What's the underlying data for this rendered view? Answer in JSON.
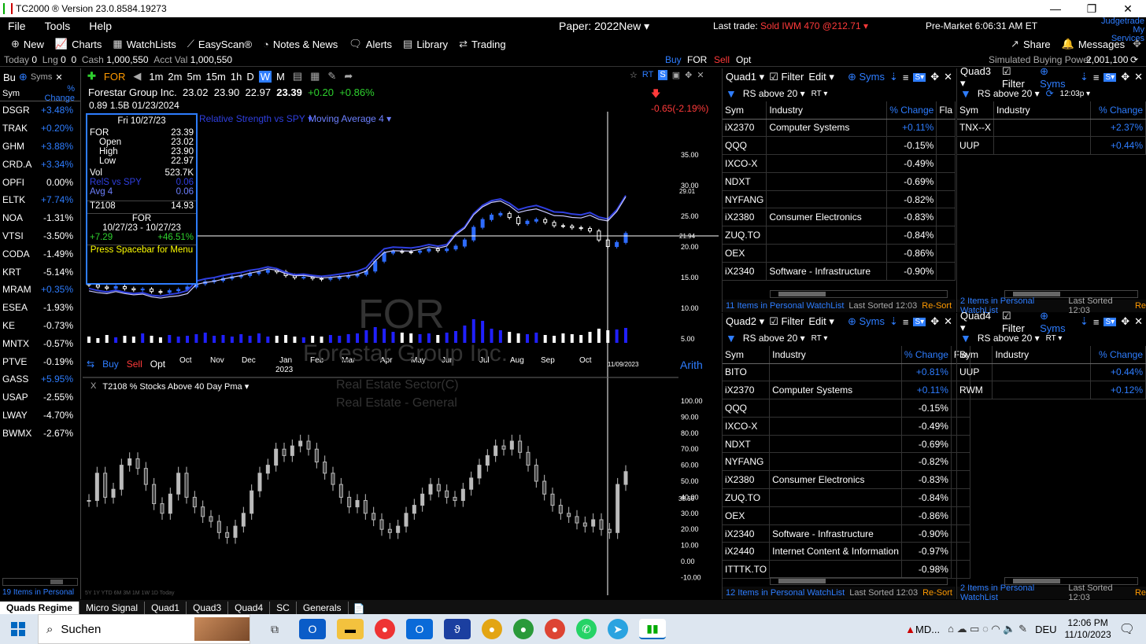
{
  "window": {
    "title": "TC2000 ® Version 23.0.8584.19273"
  },
  "menu": [
    "File",
    "Tools",
    "Help"
  ],
  "account_name": "Paper: 2022New",
  "last_trade": {
    "label": "Last trade:",
    "value": "Sold IWM 470 @212.71"
  },
  "market_status": "Pre-Market 6:06:31 AM ET",
  "brand": [
    "Judgetrade",
    "My Services"
  ],
  "toolbar": {
    "new": "New",
    "charts": "Charts",
    "watchlists": "WatchLists",
    "easyscan": "EasyScan®",
    "notes": "Notes & News",
    "alerts": "Alerts",
    "library": "Library",
    "trading": "Trading",
    "share": "Share",
    "messages": "Messages"
  },
  "acct": {
    "today_label": "Today",
    "today": "0",
    "lng_label": "Lng",
    "lng": "0",
    "val3": "0",
    "cash_label": "Cash",
    "cash": "1,000,550",
    "acctval_label": "Acct Val",
    "acctval": "1,000,550",
    "buy": "Buy",
    "sym": "FOR",
    "sell": "Sell",
    "opt": "Opt",
    "sbp_label": "Simulated Buying Power",
    "sbp": "2,001,100"
  },
  "watchlist": {
    "title": "Bu",
    "syms": "Syms",
    "col_sym": "Sym",
    "col_pct": "% Change",
    "footer": "19 Items in Personal ...",
    "rows": [
      [
        "DSGR",
        "+3.48%",
        "up"
      ],
      [
        "TRAK",
        "+0.20%",
        "up"
      ],
      [
        "GHM",
        "+3.88%",
        "up"
      ],
      [
        "CRD.A",
        "+3.34%",
        "up"
      ],
      [
        "OPFI",
        "0.00%",
        "flat"
      ],
      [
        "ELTK",
        "+7.74%",
        "up"
      ],
      [
        "NOA",
        "-1.31%",
        "dn"
      ],
      [
        "VTSI",
        "-3.50%",
        "dn"
      ],
      [
        "CODA",
        "-1.49%",
        "dn"
      ],
      [
        "KRT",
        "-5.14%",
        "dn"
      ],
      [
        "MRAM",
        "+0.35%",
        "up"
      ],
      [
        "ESEA",
        "-1.93%",
        "dn"
      ],
      [
        "KE",
        "-0.73%",
        "dn"
      ],
      [
        "MNTX",
        "-0.57%",
        "dn"
      ],
      [
        "PTVE",
        "-0.19%",
        "dn"
      ],
      [
        "GASS",
        "+5.95%",
        "up"
      ],
      [
        "USAP",
        "-2.55%",
        "dn"
      ],
      [
        "LWAY",
        "-4.70%",
        "dn"
      ],
      [
        "BWMX",
        "-2.67%",
        "dn"
      ]
    ]
  },
  "chart": {
    "symbol": "FOR",
    "timeframes": [
      "1m",
      "2m",
      "5m",
      "15m",
      "1h",
      "D",
      "W",
      "M"
    ],
    "active_tf": "W",
    "company": "Forestar Group Inc.",
    "o": "23.02",
    "h": "23.90",
    "l": "22.97",
    "c": "23.39",
    "chg": "+0.20",
    "chgp": "+0.86%",
    "line2": "0.89  1.5B  01/23/2024",
    "right_chg": "-0.65(-2.19%)",
    "ind1": "Relative Strength vs SPY",
    "ind2": "Moving Average 4",
    "wm1": "FOR",
    "wm2": "Forestar Group Inc.",
    "wm3": "Real Estate Sector(C)",
    "wm4": "Real Estate - General",
    "tooltip": {
      "date": "Fri 10/27/23",
      "sym": "FOR",
      "close": "23.39",
      "open_l": "Open",
      "open": "23.02",
      "high_l": "High",
      "high": "23.90",
      "low_l": "Low",
      "low": "22.97",
      "vol_l": "Vol",
      "vol": "523.7K",
      "rs_l": "RelS vs SPY",
      "rs": "0.06",
      "avg_l": "Avg 4",
      "avg": "0.06",
      "t_l": "T2108",
      "t": "14.93",
      "sym2": "FOR",
      "range": "10/27/23 - 10/27/23",
      "pchg": "+7.29",
      "ppct": "+46.51%",
      "menu": "Press Spacebar for Menu"
    },
    "y_ticks": [
      "35.00",
      "30.00",
      "25.00",
      "20.00",
      "15.00",
      "10.00",
      "5.00"
    ],
    "price_tag": "29.01",
    "line_tag": "21.94",
    "x_ticks": [
      "Oct",
      "Nov",
      "Dec",
      "Jan",
      "Feb",
      "Mar",
      "Apr",
      "May",
      "Jun",
      "Jul",
      "Aug",
      "Sep",
      "Oct"
    ],
    "year": "2023",
    "cursor_date": "11/09/2023",
    "trade": [
      "Buy",
      "Sell",
      "Opt"
    ],
    "scale": "Arith",
    "pane2_title": "T2108 % Stocks Above 40 Day Pma",
    "pane2_close": "X",
    "y2_ticks": [
      "100.00",
      "90.00",
      "80.00",
      "70.00",
      "60.00",
      "50.00",
      "40.00",
      "30.00",
      "20.00",
      "10.00",
      "0.00",
      "-10.00"
    ],
    "pane2_tag": "38.66",
    "range_btns": "5Y 1Y YTD 6M 3M 1M 1W 1D Today"
  },
  "quads": [
    {
      "id": "q1",
      "title": "Quad1",
      "filter": "Filter",
      "edit": "Edit",
      "syms": "Syms",
      "cond": "RS above 20",
      "rt": "RT",
      "cols": [
        "Sym",
        "Industry",
        "% Change",
        "Fla"
      ],
      "rows": [
        [
          "iX2370",
          "Computer Systems",
          "+0.11%"
        ],
        [
          "QQQ",
          "",
          "-0.15%"
        ],
        [
          "IXCO-X",
          "",
          "-0.49%"
        ],
        [
          "NDXT",
          "",
          "-0.69%"
        ],
        [
          "NYFANG",
          "",
          "-0.82%"
        ],
        [
          "iX2380",
          "Consumer Electronics",
          "-0.83%"
        ],
        [
          "ZUQ.TO",
          "",
          "-0.84%"
        ],
        [
          "OEX",
          "",
          "-0.86%"
        ],
        [
          "iX2340",
          "Software - Infrastructure",
          "-0.90%"
        ]
      ],
      "footer": "11 Items in Personal WatchList",
      "sorted": "Last Sorted 12:03",
      "resort": "Re-Sort"
    },
    {
      "id": "q2",
      "title": "Quad2",
      "filter": "Filter",
      "edit": "Edit",
      "syms": "Syms",
      "cond": "RS above 20",
      "rt": "RT",
      "cols": [
        "Sym",
        "Industry",
        "% Change",
        "Fla"
      ],
      "rows": [
        [
          "BITO",
          "",
          "+0.81%"
        ],
        [
          "iX2370",
          "Computer Systems",
          "+0.11%"
        ],
        [
          "QQQ",
          "",
          "-0.15%"
        ],
        [
          "IXCO-X",
          "",
          "-0.49%"
        ],
        [
          "NDXT",
          "",
          "-0.69%"
        ],
        [
          "NYFANG",
          "",
          "-0.82%"
        ],
        [
          "iX2380",
          "Consumer Electronics",
          "-0.83%"
        ],
        [
          "ZUQ.TO",
          "",
          "-0.84%"
        ],
        [
          "OEX",
          "",
          "-0.86%"
        ],
        [
          "iX2340",
          "Software - Infrastructure",
          "-0.90%"
        ],
        [
          "iX2440",
          "Internet Content & Information",
          "-0.97%"
        ],
        [
          "ITTTK.TO",
          "",
          "-0.98%"
        ]
      ],
      "footer": "12 Items in Personal WatchList",
      "sorted": "Last Sorted 12:03",
      "resort": "Re-Sort"
    },
    {
      "id": "q3",
      "title": "Quad3",
      "filter": "Filter",
      "syms": "Syms",
      "cond": "RS above 20",
      "rt": "12:03p",
      "cols": [
        "Sym",
        "Industry",
        "% Change"
      ],
      "rows": [
        [
          "TNX--X",
          "",
          "+2.37%"
        ],
        [
          "UUP",
          "",
          "+0.44%"
        ]
      ],
      "footer": "2 Items in Personal WatchList",
      "sorted": "Last Sorted 12:03",
      "resort": "Re"
    },
    {
      "id": "q4",
      "title": "Quad4",
      "filter": "Filter",
      "syms": "Syms",
      "cond": "RS above 20",
      "rt": "RT",
      "cols": [
        "Sym",
        "Industry",
        "% Change"
      ],
      "rows": [
        [
          "UUP",
          "",
          "+0.44%"
        ],
        [
          "RWM",
          "",
          "+0.12%"
        ]
      ],
      "footer": "2 Items in Personal WatchList",
      "sorted": "Last Sorted 12:03",
      "resort": "Re"
    }
  ],
  "tabs": [
    "Quads Regime",
    "Micro Signal",
    "Quad1",
    "Quad3",
    "Quad4",
    "SC",
    "Generals"
  ],
  "taskbar": {
    "search": "Suchen",
    "tray_app": "MD...",
    "lang": "DEU",
    "time": "12:06 PM",
    "date": "11/10/2023"
  },
  "colors": {
    "up": "#2e7dff",
    "down": "#ffffff",
    "accent": "#2e7dff",
    "sell": "#ff3a3a",
    "gain": "#2ed02e"
  }
}
